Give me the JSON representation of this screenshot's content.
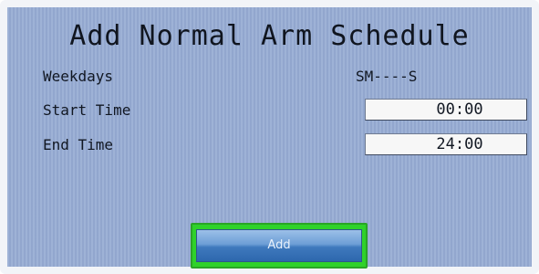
{
  "dialog": {
    "title": "Add Normal Arm Schedule"
  },
  "fields": {
    "weekdays": {
      "label": "Weekdays",
      "value": "SM----S"
    },
    "start_time": {
      "label": "Start Time",
      "value": "00:00"
    },
    "end_time": {
      "label": "End Time",
      "value": "24:00"
    }
  },
  "actions": {
    "add_label": "Add"
  },
  "colors": {
    "background": "#97acd3",
    "focus_highlight": "#2fd22a",
    "button": "#3f79bd"
  }
}
